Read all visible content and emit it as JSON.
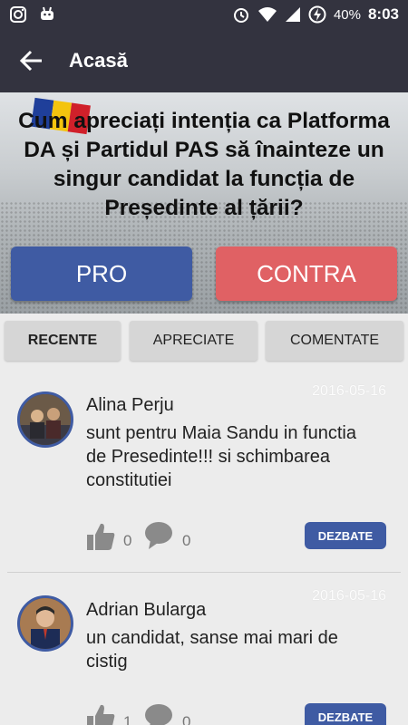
{
  "status_bar": {
    "battery": "40%",
    "time": "8:03"
  },
  "app_bar": {
    "title": "Acasă"
  },
  "poll": {
    "question": "Cum apreciați intenția ca Platforma DA și Partidul PAS să înainteze un singur candidat la funcția de Președinte al țării?",
    "pro_label": "PRO",
    "contra_label": "CONTRA"
  },
  "tabs": [
    {
      "label": "RECENTE"
    },
    {
      "label": "APRECIATE"
    },
    {
      "label": "COMENTATE"
    }
  ],
  "comments": [
    {
      "author": "Alina Perju",
      "date": "2016-05-16",
      "text": "sunt pentru Maia Sandu in functia de Presedinte!!!  si schimbarea constitutiei",
      "likes": "0",
      "replies": "0",
      "action": "DEZBATE"
    },
    {
      "author": "Adrian Bularga",
      "date": "2016-05-16",
      "text": "un candidat, sanse mai mari de cistig",
      "likes": "1",
      "replies": "0",
      "action": "DEZBATE"
    }
  ],
  "colors": {
    "bar": "#33333f",
    "pro": "#3f5ba3",
    "contra": "#e06164",
    "flag_blue": "#1f3f9a",
    "flag_yellow": "#f4c40e",
    "flag_red": "#d0202a"
  },
  "icons": [
    "instagram-icon",
    "android-icon",
    "alarm-icon",
    "wifi-icon",
    "signal-icon",
    "battery-icon",
    "back-arrow-icon",
    "thumbs-up-icon",
    "comment-icon"
  ]
}
